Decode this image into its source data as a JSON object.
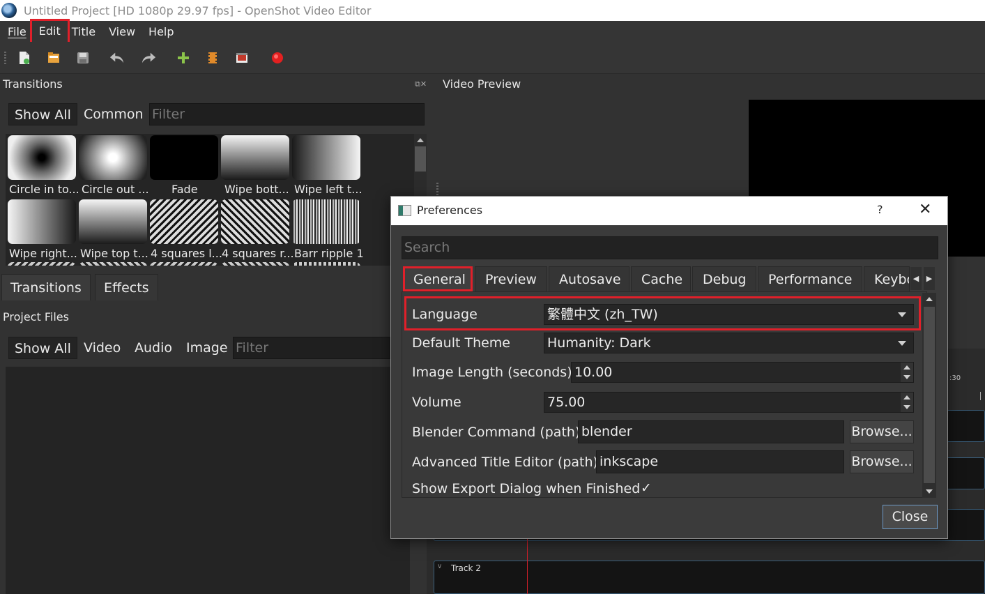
{
  "window": {
    "title": "Untitled Project [HD 1080p 29.97 fps] - OpenShot Video Editor"
  },
  "menu": [
    "File",
    "Edit",
    "Title",
    "View",
    "Help"
  ],
  "toolbar_icons": [
    "new-project-icon",
    "open-project-icon",
    "save-project-icon",
    "undo-icon",
    "redo-icon",
    "import-files-icon",
    "profile-icon",
    "fullscreen-icon",
    "export-video-icon"
  ],
  "transitions": {
    "title": "Transitions",
    "filters": {
      "show_all": "Show All",
      "common": "Common"
    },
    "filter_placeholder": "Filter",
    "items": [
      "Circle in to...",
      "Circle out ...",
      "Fade",
      "Wipe bott...",
      "Wipe left t...",
      "Wipe right...",
      "Wipe top t...",
      "4 squares l...",
      "4 squares r...",
      "Barr ripple 1"
    ]
  },
  "bottom_tabs": {
    "transitions": "Transitions",
    "effects": "Effects"
  },
  "project_files": {
    "title": "Project Files",
    "filters": {
      "show_all": "Show All",
      "video": "Video",
      "audio": "Audio",
      "image": "Image"
    },
    "filter_placeholder": "Filter"
  },
  "video_preview": {
    "title": "Video Preview"
  },
  "timeline": {
    "time_marker": ":30",
    "track_label": "Track 2"
  },
  "preferences": {
    "title": "Preferences",
    "help": "?",
    "close_x": "✕",
    "search_placeholder": "Search",
    "tabs": [
      "General",
      "Preview",
      "Autosave",
      "Cache",
      "Debug",
      "Performance",
      "Keybo"
    ],
    "active_tab": "General",
    "rows": {
      "language": {
        "label": "Language",
        "value": "繁體中文 (zh_TW)"
      },
      "theme": {
        "label": "Default Theme",
        "value": "Humanity: Dark"
      },
      "image_length": {
        "label": "Image Length (seconds)",
        "value": "10.00"
      },
      "volume": {
        "label": "Volume",
        "value": "75.00"
      },
      "blender": {
        "label": "Blender Command (path)",
        "value": "blender",
        "button": "Browse..."
      },
      "title_editor": {
        "label": "Advanced Title Editor (path)",
        "value": "inkscape",
        "button": "Browse..."
      },
      "export_dialog": {
        "label": "Show Export Dialog when Finished",
        "checked": "✓"
      }
    },
    "close_button": "Close"
  },
  "colors": {
    "highlight": "#e0202a",
    "panel_bg": "#323232",
    "dialog_bg": "#3b3b3b",
    "accent_border": "#6f9bc7"
  }
}
